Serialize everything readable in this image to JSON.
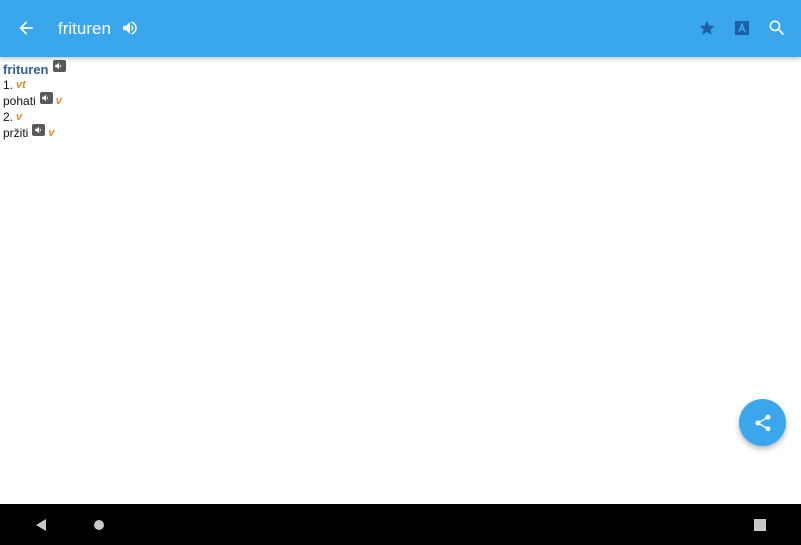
{
  "app_bar": {
    "title": "frituren",
    "icons": {
      "back": "arrow-left-icon",
      "speak": "speaker-icon",
      "favorite": "star-icon",
      "translate": "letter-a-box-icon",
      "search": "search-icon"
    },
    "color": "#3aa7ec"
  },
  "entry": {
    "headword": "frituren",
    "senses": [
      {
        "number": "1.",
        "pos": "vt",
        "translation": "pohati",
        "translation_pos": "v"
      },
      {
        "number": "2.",
        "pos": "v",
        "translation": "pržiti",
        "translation_pos": "v"
      }
    ],
    "colors": {
      "headword": "#2f5f9e",
      "pos": "#e58a2a"
    }
  },
  "fab": {
    "icon": "share-icon"
  },
  "nav_bar": {
    "icons": [
      "back-triangle-icon",
      "home-circle-icon",
      "recents-square-icon"
    ]
  }
}
